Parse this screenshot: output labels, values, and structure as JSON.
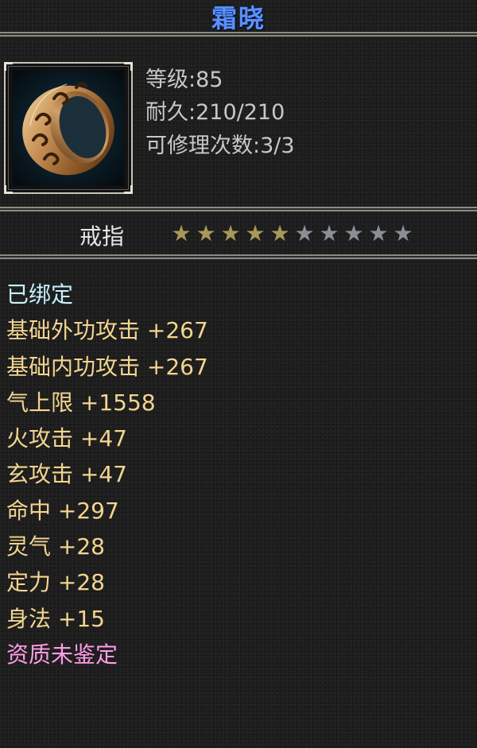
{
  "item": {
    "name": "霜晓",
    "level_text": "等级:85",
    "durability_text": "耐久:210/210",
    "repair_text": "可修理次数:3/3",
    "type": "戒指",
    "stars_filled": 5,
    "stars_total": 10,
    "icon": "bronze-ring-icon"
  },
  "colors": {
    "title": "#5a90ff",
    "bound": "#c8f0ff",
    "attribute": "#f3d58f",
    "quality": "#ff9ce6",
    "star_filled": "#a8985a",
    "star_empty": "#8a8f96"
  },
  "attributes": [
    {
      "text": "已绑定",
      "kind": "bound"
    },
    {
      "text": "基础外功攻击 +267",
      "kind": "attribute"
    },
    {
      "text": "基础内功攻击 +267",
      "kind": "attribute"
    },
    {
      "text": "气上限 +1558",
      "kind": "attribute"
    },
    {
      "text": "火攻击 +47",
      "kind": "attribute"
    },
    {
      "text": "玄攻击 +47",
      "kind": "attribute"
    },
    {
      "text": "命中 +297",
      "kind": "attribute"
    },
    {
      "text": "灵气 +28",
      "kind": "attribute"
    },
    {
      "text": "定力 +28",
      "kind": "attribute"
    },
    {
      "text": "身法 +15",
      "kind": "attribute"
    },
    {
      "text": "资质未鉴定",
      "kind": "quality"
    }
  ]
}
